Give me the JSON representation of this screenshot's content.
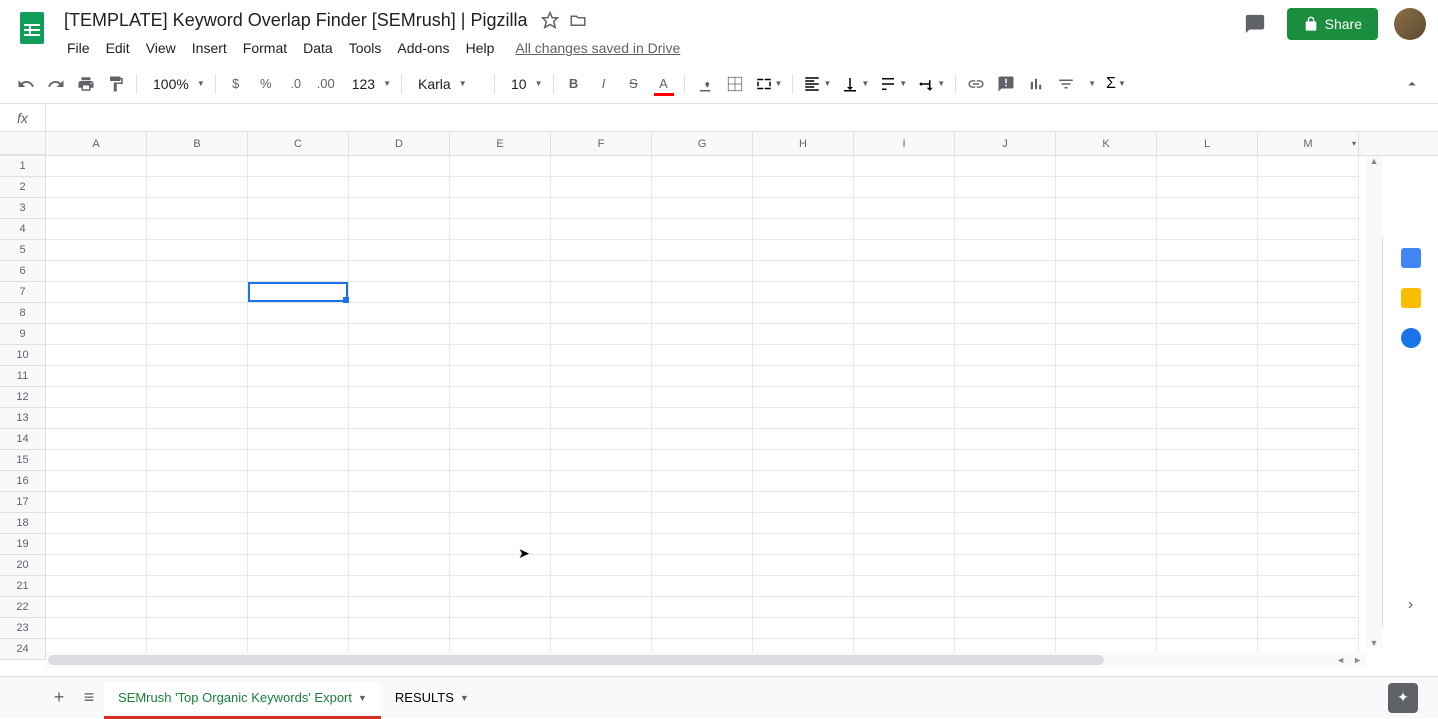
{
  "header": {
    "title": "[TEMPLATE] Keyword Overlap Finder [SEMrush] | Pigzilla",
    "save_status": "All changes saved in Drive",
    "share_label": "Share"
  },
  "menus": [
    "File",
    "Edit",
    "View",
    "Insert",
    "Format",
    "Data",
    "Tools",
    "Add-ons",
    "Help"
  ],
  "toolbar": {
    "zoom": "100%",
    "format_number": "123",
    "font": "Karla",
    "font_size": "10"
  },
  "columns": [
    "A",
    "B",
    "C",
    "D",
    "E",
    "F",
    "G",
    "H",
    "I",
    "J",
    "K",
    "L",
    "M"
  ],
  "rows": [
    1,
    2,
    3,
    4,
    5,
    6,
    7,
    8,
    9,
    10,
    11,
    12,
    13,
    14,
    15,
    16,
    17,
    18,
    19,
    20,
    21,
    22,
    23,
    24
  ],
  "selected_cell": "C7",
  "formula_value": "",
  "tabs": [
    {
      "name": "SEMrush 'Top Organic Keywords' Export",
      "active": true
    },
    {
      "name": "RESULTS",
      "active": false
    }
  ]
}
